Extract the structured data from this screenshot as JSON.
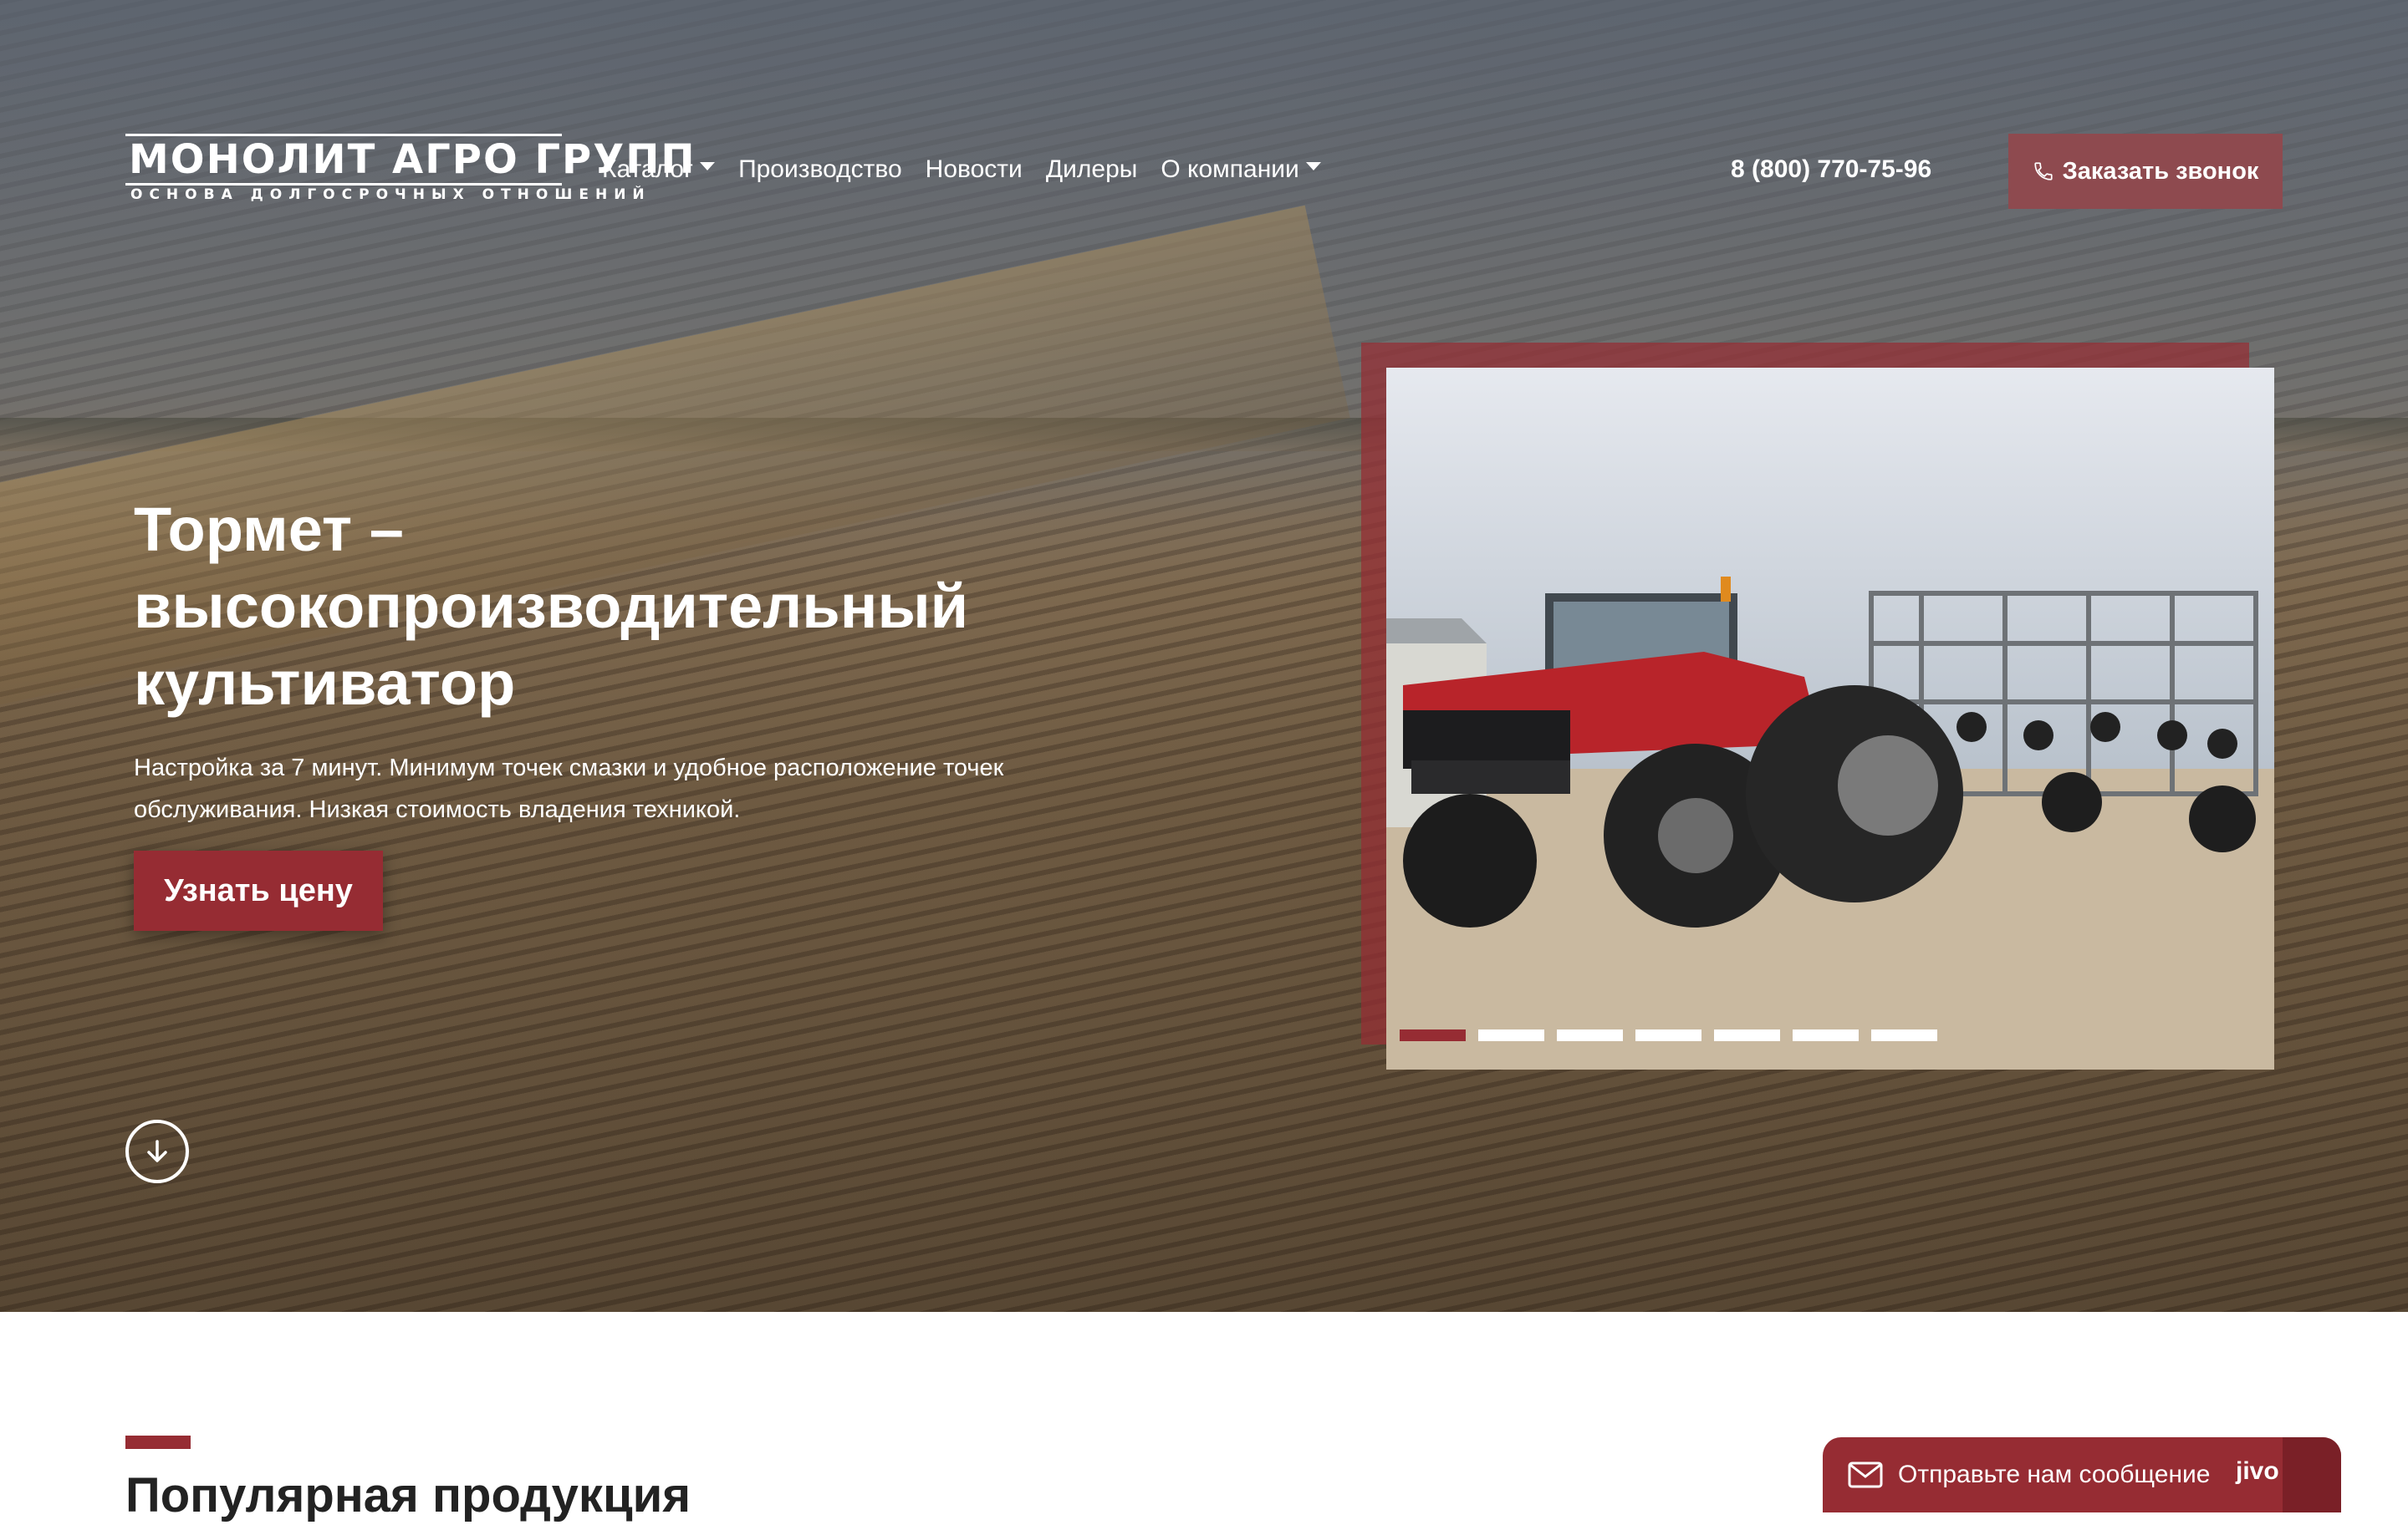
{
  "header": {
    "logo": {
      "main": "МОНОЛИТ АГРО ГРУПП",
      "tagline": "ОСНОВА ДОЛГОСРОЧНЫХ ОТНОШЕНИЙ"
    },
    "nav": [
      {
        "label": "Каталог",
        "dropdown": true
      },
      {
        "label": "Производство",
        "dropdown": false
      },
      {
        "label": "Новости",
        "dropdown": false
      },
      {
        "label": "Дилеры",
        "dropdown": false
      },
      {
        "label": "О компании",
        "dropdown": true
      }
    ],
    "phone": "8 (800) 770-75-96",
    "callback_label": "Заказать звонок"
  },
  "hero": {
    "title": "Тормет – высокопроизводительный культиватор",
    "description": "Настройка за 7 минут. Минимум точек смазки и удобное расположение точек обслуживания. Низкая стоимость владения техникой.",
    "cta_label": "Узнать цену",
    "slider": {
      "total": 7,
      "active": 1
    }
  },
  "section": {
    "title": "Популярная продукция"
  },
  "chat": {
    "message": "Отправьте нам сообщение",
    "brand": "jivo"
  },
  "colors": {
    "accent": "#962c33",
    "accent_muted": "#8e4a4f",
    "text_dark": "#222222"
  },
  "icons": {
    "callback": "phone-icon",
    "scroll": "arrow-down-circle-icon",
    "chat": "envelope-icon",
    "nav_dropdown": "caret-down-icon"
  }
}
